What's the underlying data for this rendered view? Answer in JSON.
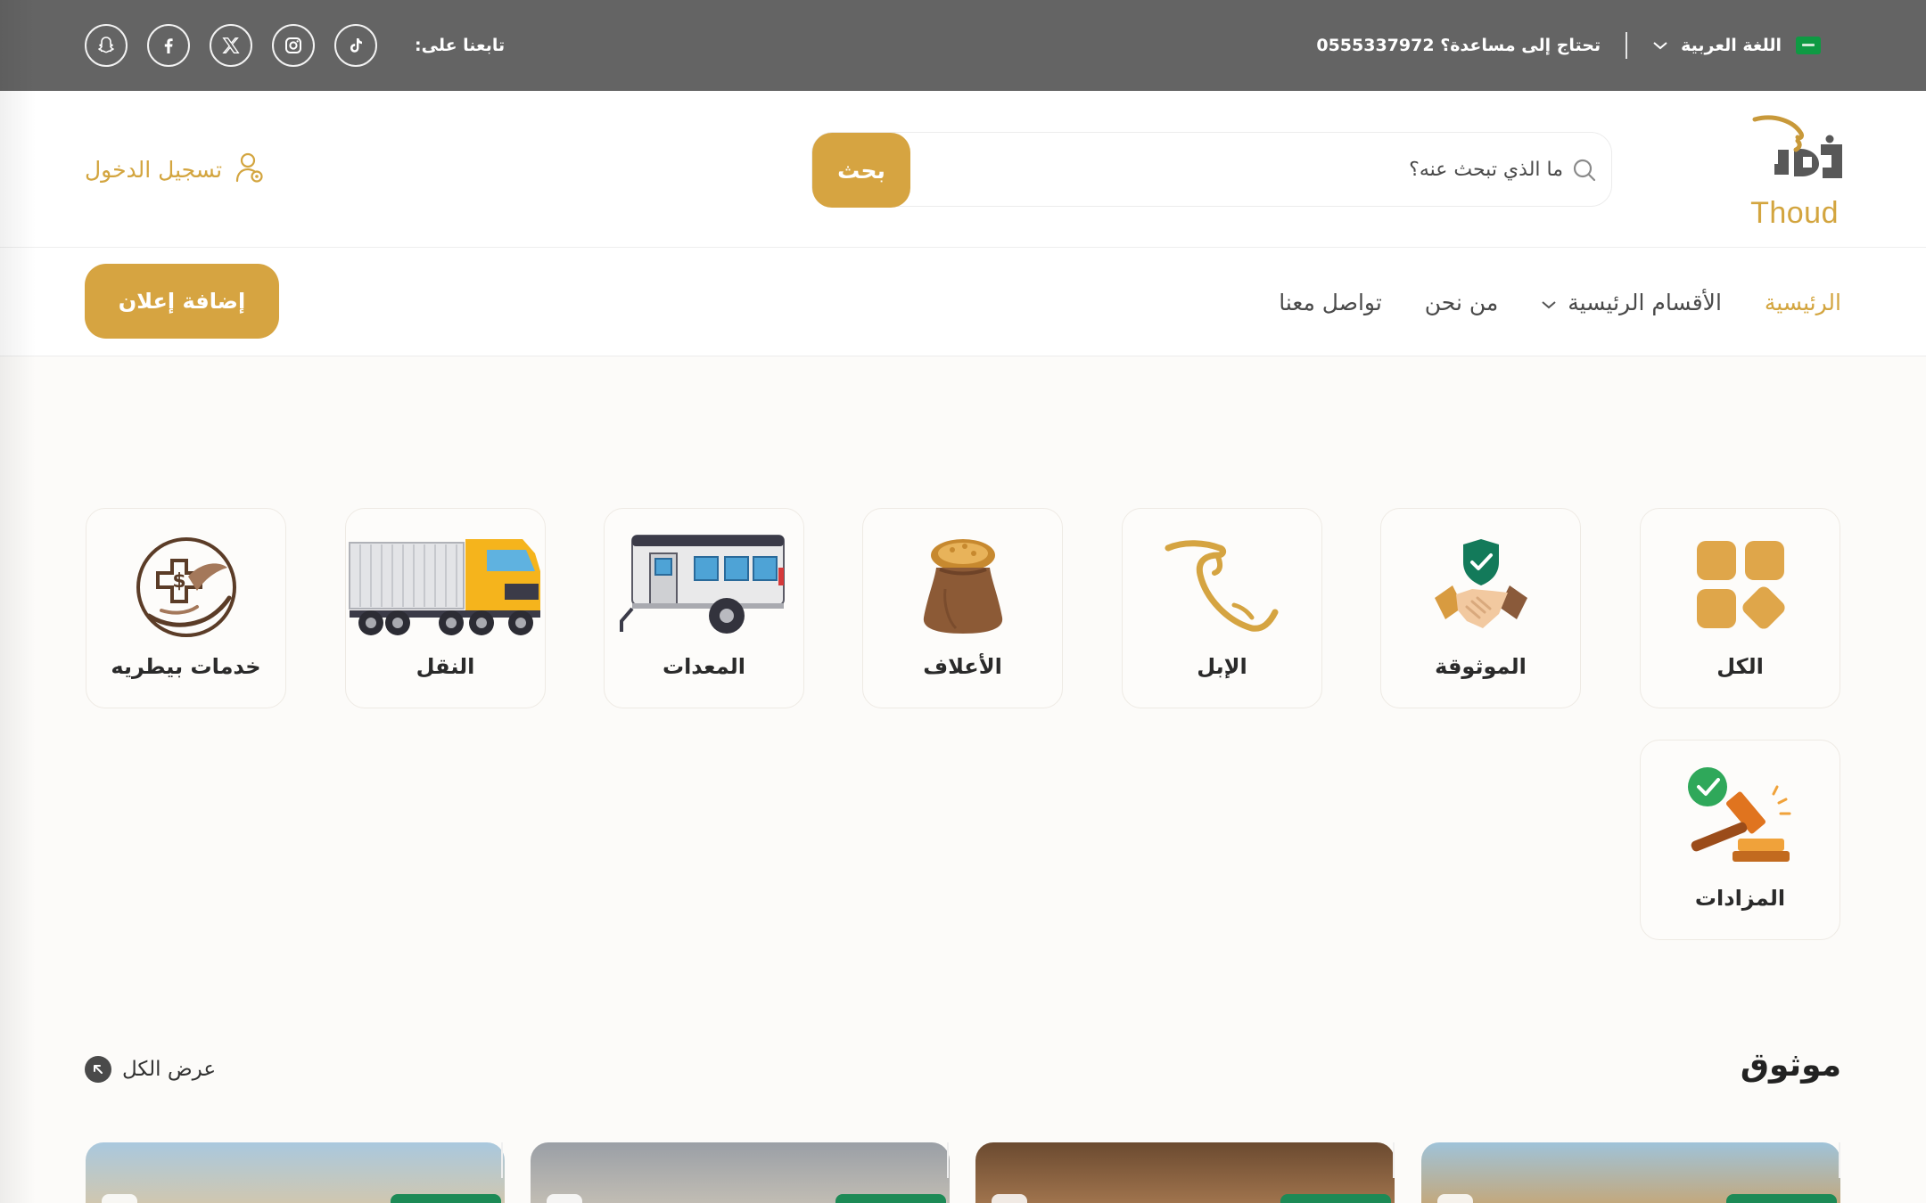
{
  "topbar": {
    "language": "اللغة العربية",
    "help_text": "تحتاج إلى مساعدة؟",
    "phone": "0555337972",
    "follow_label": "تابعنا على:",
    "social": [
      "snapchat-icon",
      "facebook-icon",
      "x-icon",
      "instagram-icon",
      "tiktok-icon"
    ]
  },
  "header": {
    "logo_text": "Thoud",
    "search_placeholder": "ما الذي تبحث عنه؟",
    "search_button": "بحث",
    "login_label": "تسجيل الدخول"
  },
  "nav": {
    "items": [
      {
        "label": "الرئيسية",
        "active": true
      },
      {
        "label": "الأقسام الرئيسية",
        "dropdown": true
      },
      {
        "label": "من نحن"
      },
      {
        "label": "تواصل معنا"
      }
    ],
    "add_ad": "إضافة إعلان"
  },
  "categories": [
    {
      "label": "الكل",
      "icon": "grid-icon"
    },
    {
      "label": "الموثوقة",
      "icon": "verified-handshake-icon"
    },
    {
      "label": "الإبل",
      "icon": "camel-logo-icon"
    },
    {
      "label": "الأعلاف",
      "icon": "feed-sack-icon"
    },
    {
      "label": "المعدات",
      "icon": "trailer-icon"
    },
    {
      "label": "النقل",
      "icon": "truck-icon"
    },
    {
      "label": "خدمات بيطريه",
      "icon": "veterinary-icon"
    },
    {
      "label": "المزادات",
      "icon": "auction-gavel-icon"
    }
  ],
  "section": {
    "title": "موثوق",
    "view_all": "عرض الكل"
  },
  "colors": {
    "topbar": "#646464",
    "accent": "#d6a441",
    "verified_green": "#1d8a56"
  }
}
